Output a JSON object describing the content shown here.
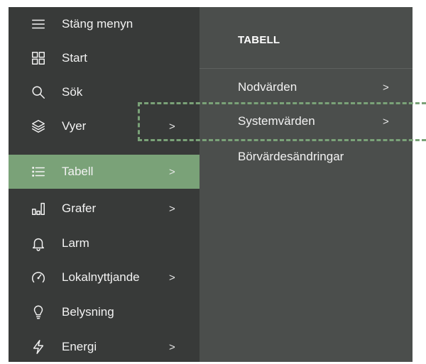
{
  "sidebar": {
    "items": [
      {
        "label": "Stäng menyn",
        "icon": "hamburger-icon",
        "chevron": ""
      },
      {
        "label": "Start",
        "icon": "grid-icon",
        "chevron": ""
      },
      {
        "label": "Sök",
        "icon": "search-icon",
        "chevron": ""
      },
      {
        "label": "Vyer",
        "icon": "layers-icon",
        "chevron": ">"
      },
      {
        "label": "Tabell",
        "icon": "list-icon",
        "chevron": ">"
      },
      {
        "label": "Grafer",
        "icon": "bar-chart-icon",
        "chevron": ">"
      },
      {
        "label": "Larm",
        "icon": "bell-icon",
        "chevron": ""
      },
      {
        "label": "Lokalnyttjande",
        "icon": "gauge-icon",
        "chevron": ">"
      },
      {
        "label": "Belysning",
        "icon": "lightbulb-icon",
        "chevron": ""
      },
      {
        "label": "Energi",
        "icon": "lightning-icon",
        "chevron": ">"
      }
    ],
    "active_label": "Tabell"
  },
  "submenu": {
    "title": "TABELL",
    "items": [
      {
        "label": "Nodvärden",
        "chevron": ">"
      },
      {
        "label": "Systemvärden",
        "chevron": ">"
      },
      {
        "label": "Börvärdesändringar",
        "chevron": ""
      }
    ]
  },
  "colors": {
    "sidebar_bg": "#383a39",
    "panel_bg": "#4b4e4c",
    "accent": "#7aa278",
    "text": "#f2f2f2"
  }
}
